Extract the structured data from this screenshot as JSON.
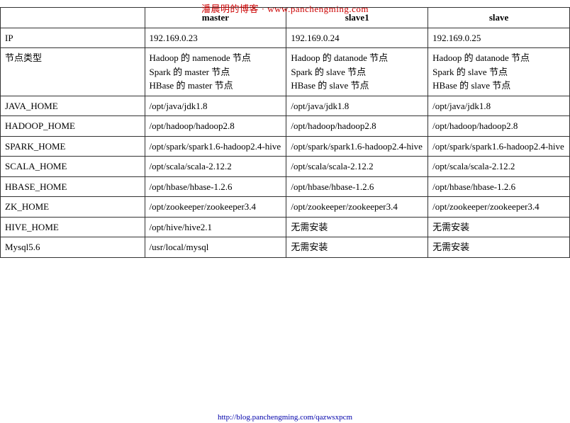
{
  "watermark_top": "潘晨明的博客 · www.panchengming.com",
  "watermark_bottom": "http://blog.panchengming.com/qazwsxpcm",
  "table": {
    "headers": [
      "",
      "master",
      "slave1",
      "slave"
    ],
    "rows": [
      {
        "label": "IP",
        "master": "192.169.0.23",
        "slave1": "192.169.0.24",
        "slave2": "192.169.0.25"
      },
      {
        "label": "节点类型",
        "master": "Hadoop 的 namenode 节点\nSpark 的 master 节点\nHBase 的 master 节点",
        "slave1": "Hadoop 的 datanode 节点\nSpark 的 slave 节点\nHBase 的 slave 节点",
        "slave2": "Hadoop 的 datanode 节点\nSpark 的 slave 节点\nHBase 的 slave 节点"
      },
      {
        "label": "JAVA_HOME",
        "master": "/opt/java/jdk1.8",
        "slave1": "/opt/java/jdk1.8",
        "slave2": "/opt/java/jdk1.8"
      },
      {
        "label": "HADOOP_HOME",
        "master": "/opt/hadoop/hadoop2.8",
        "slave1": "/opt/hadoop/hadoop2.8",
        "slave2": "/opt/hadoop/hadoop2.8"
      },
      {
        "label": "SPARK_HOME",
        "master": "/opt/spark/spark1.6-hadoop2.4-hive",
        "slave1": "/opt/spark/spark1.6-hadoop2.4-hive",
        "slave2": "/opt/spark/spark1.6-hadoop2.4-hive"
      },
      {
        "label": "SCALA_HOME",
        "master": "/opt/scala/scala-2.12.2",
        "slave1": "/opt/scala/scala-2.12.2",
        "slave2": "/opt/scala/scala-2.12.2"
      },
      {
        "label": "HBASE_HOME",
        "master": "/opt/hbase/hbase-1.2.6",
        "slave1": "/opt/hbase/hbase-1.2.6",
        "slave2": "/opt/hbase/hbase-1.2.6"
      },
      {
        "label": "ZK_HOME",
        "master": "/opt/zookeeper/zookeeper3.4",
        "slave1": "/opt/zookeeper/zookeeper3.4",
        "slave2": "/opt/zookeeper/zookeeper3.4"
      },
      {
        "label": "HIVE_HOME",
        "master": "/opt/hive/hive2.1",
        "slave1": "无需安装",
        "slave2": "无需安装"
      },
      {
        "label": "Mysql5.6",
        "master": "/usr/local/mysql",
        "slave1": "无需安装",
        "slave2": "无需安装"
      }
    ]
  }
}
